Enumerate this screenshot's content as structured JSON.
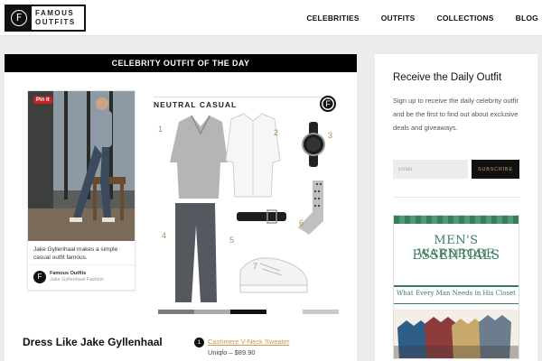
{
  "header": {
    "logo_line1": "FAMOUS",
    "logo_line2": "OUTFITS",
    "logo_glyph": "F",
    "nav": [
      "CELEBRITIES",
      "OUTFITS",
      "COLLECTIONS",
      "BLOG"
    ]
  },
  "main": {
    "banner": "CELEBRITY OUTFIT OF THE DAY",
    "pin": {
      "button": "Pin it",
      "caption": "Jake Gyllenhaal makes a simple casual outfit famous.",
      "author": "Famous Outfits",
      "board": "Jake Gyllenhaal Fashion"
    },
    "collage": {
      "title": "NEUTRAL CASUAL",
      "numbers": [
        "1",
        "2",
        "3",
        "4",
        "5",
        "6",
        "7"
      ],
      "swatch_colors": [
        "#7a7a7a",
        "#a9a9a9",
        "#111111",
        "#ffffff",
        "#c8c8c8"
      ]
    },
    "outfit_title": "Dress Like Jake Gyllenhaal",
    "items": [
      {
        "num": "1",
        "name": "Cashmere V-Neck Sweater",
        "price": "Uniqlo – $89.90"
      }
    ]
  },
  "sidebar": {
    "title": "Receive the Daily Outfit",
    "text": "Sign up to receive the daily celebrity outfit and be the first to find out about exclusive deals and giveaways.",
    "email_placeholder": "Email",
    "subscribe_label": "SUBSCRIBE",
    "ad": {
      "title_line1": "MEN'S WARDROBE",
      "title_line2": "ESSENTIALS",
      "subtitle": "What Every Man Needs in His Closet"
    }
  },
  "colors": {
    "accent_gold": "#c59a52",
    "brand_black": "#111111",
    "ad_green": "#3a7d5c"
  }
}
